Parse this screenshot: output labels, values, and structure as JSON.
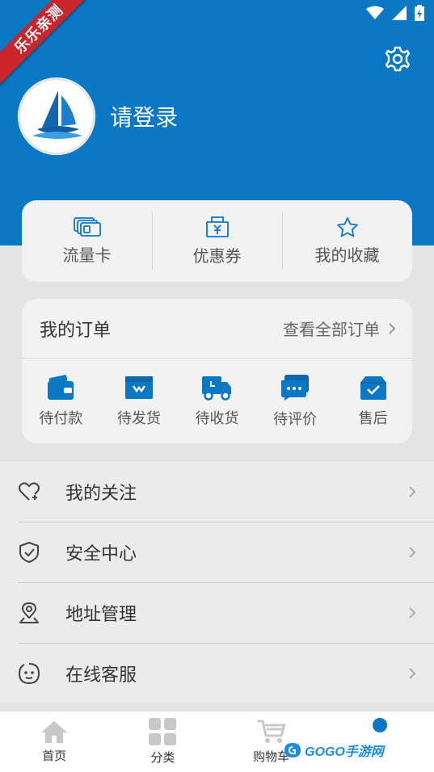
{
  "ribbon_text": "乐乐亲测",
  "header": {
    "login_text": "请登录"
  },
  "quick_links": [
    {
      "label": "流量卡",
      "icon": "sim-card-icon"
    },
    {
      "label": "优惠券",
      "icon": "coupon-icon"
    },
    {
      "label": "我的收藏",
      "icon": "star-icon"
    }
  ],
  "orders": {
    "title": "我的订单",
    "view_all": "查看全部订单",
    "items": [
      {
        "label": "待付款",
        "icon": "wallet-icon"
      },
      {
        "label": "待发货",
        "icon": "package-icon"
      },
      {
        "label": "待收货",
        "icon": "truck-icon"
      },
      {
        "label": "待评价",
        "icon": "comment-icon"
      },
      {
        "label": "售后",
        "icon": "bag-icon"
      }
    ]
  },
  "menu": [
    {
      "label": "我的关注",
      "icon": "heart-plus-icon"
    },
    {
      "label": "安全中心",
      "icon": "shield-icon"
    },
    {
      "label": "地址管理",
      "icon": "location-icon"
    },
    {
      "label": "在线客服",
      "icon": "chat-face-icon"
    }
  ],
  "tabbar": [
    {
      "label": "首页",
      "icon": "home-icon"
    },
    {
      "label": "分类",
      "icon": "grid-icon"
    },
    {
      "label": "购物车",
      "icon": "cart-icon"
    },
    {
      "label": "",
      "icon": "profile-icon"
    }
  ],
  "watermark_text": "GOGO手游网",
  "colors": {
    "primary": "#0b78c5",
    "background": "#e5e5e5",
    "card": "#f2f2f2"
  }
}
